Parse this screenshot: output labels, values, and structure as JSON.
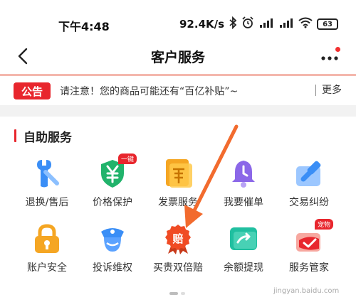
{
  "status_bar": {
    "time": "下午4:48",
    "net_speed": "92.4K/s",
    "battery": "63"
  },
  "nav": {
    "title": "客户服务"
  },
  "notice": {
    "tag": "公告",
    "text": "请注意！您的商品可能还有“百亿补贴”~",
    "more": "更多"
  },
  "section": {
    "title": "自助服务"
  },
  "services": [
    {
      "label": "退换/售后",
      "icon": "wrench-icon",
      "color": "#3a8ef6"
    },
    {
      "label": "价格保护",
      "icon": "price-shield-icon",
      "color": "#21b36b",
      "badge": "一键"
    },
    {
      "label": "发票服务",
      "icon": "invoice-icon",
      "color": "#f5a623"
    },
    {
      "label": "我要催单",
      "icon": "bell-icon",
      "color": "#8b67e8"
    },
    {
      "label": "交易纠纷",
      "icon": "gavel-icon",
      "color": "#3a8ef6"
    },
    {
      "label": "账户安全",
      "icon": "lock-icon",
      "color": "#f5a623"
    },
    {
      "label": "投诉维权",
      "icon": "police-icon",
      "color": "#3a8ef6"
    },
    {
      "label": "买贵双倍赔",
      "icon": "compensation-icon",
      "color": "#f04b24",
      "icon_text": "赔"
    },
    {
      "label": "余额提现",
      "icon": "withdraw-icon",
      "color": "#20bfa0"
    },
    {
      "label": "服务管家",
      "icon": "pet-service-icon",
      "color": "#e8262d",
      "badge": "宠物"
    }
  ],
  "colors": {
    "accent": "#e8262d",
    "annotation_arrow": "#f26b2e"
  },
  "watermark": "jingyan.baidu.com"
}
